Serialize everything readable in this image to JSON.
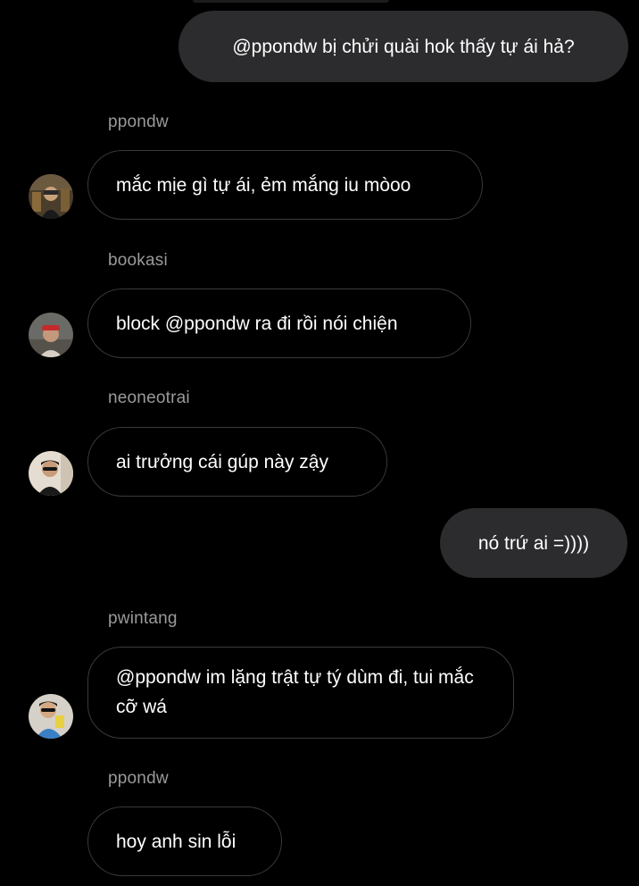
{
  "messages": [
    {
      "type": "outgoing",
      "text": "@ppondw bị chửi quài hok thấy tự ái hả?"
    },
    {
      "type": "incoming",
      "sender": "ppondw",
      "text": "mắc mịe gì tự ái, ẻm mắng iu mòoo",
      "avatar": "user-avatar-icon"
    },
    {
      "type": "incoming",
      "sender": "bookasi",
      "text": "block @ppondw ra đi rồi nói chiện",
      "avatar": "user-avatar-icon"
    },
    {
      "type": "incoming",
      "sender": "neoneotrai",
      "text": "ai trưởng cái gúp này zậy",
      "avatar": "user-avatar-icon"
    },
    {
      "type": "outgoing",
      "text": "nó trứ ai =))))"
    },
    {
      "type": "incoming",
      "sender": "pwintang",
      "text": "@ppondw im lặng trật tự tý dùm đi, tui mắc cỡ wá",
      "avatar": "user-avatar-icon"
    },
    {
      "type": "incoming",
      "sender": "ppondw",
      "text": "hoy anh sin lỗi"
    }
  ],
  "colors": {
    "background": "#000000",
    "outgoing_bubble": "#2c2c2e",
    "incoming_border": "#3a3a3c",
    "sender_name": "#9a9a9a",
    "text": "#ffffff"
  }
}
